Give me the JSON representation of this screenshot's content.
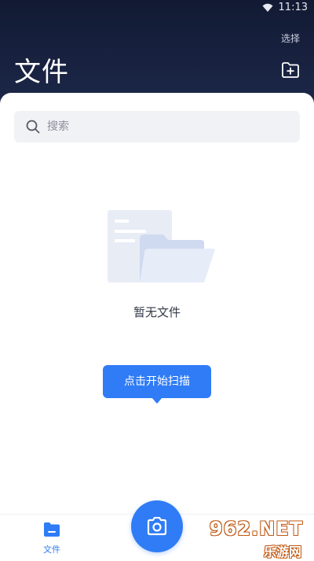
{
  "status_bar": {
    "time": "11:13",
    "wifi_icon": "wifi-icon"
  },
  "header": {
    "select_label": "选择",
    "title": "文件",
    "new_folder_icon": "new-folder-icon"
  },
  "search": {
    "placeholder": "搜索",
    "value": "",
    "icon": "search-icon"
  },
  "empty_state": {
    "text": "暂无文件",
    "illustration": "empty-folder-illustration"
  },
  "scan_tip": {
    "label": "点击开始扫描"
  },
  "bottom_nav": {
    "tabs": [
      {
        "label": "文件",
        "icon": "folder-icon",
        "active": true
      }
    ],
    "camera_icon": "camera-icon"
  },
  "watermark": {
    "top": "962.NET",
    "bottom": "乐游网"
  },
  "colors": {
    "accent": "#2f7cf6",
    "header_bg": "#1b2440",
    "search_bg": "#f1f2f5"
  }
}
